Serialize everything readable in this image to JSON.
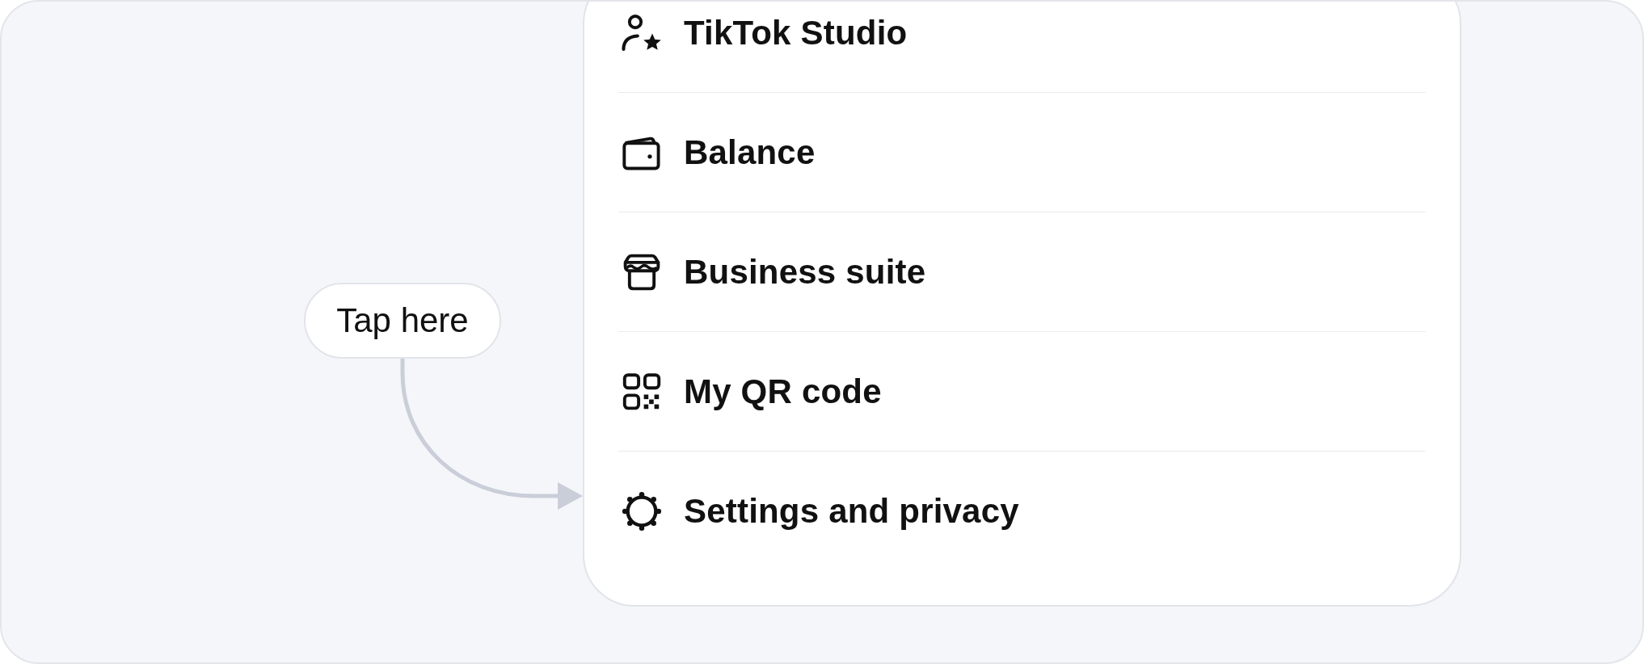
{
  "callout": {
    "text": "Tap here"
  },
  "menu": {
    "items": [
      {
        "kind": "studio",
        "label": "TikTok Studio"
      },
      {
        "kind": "wallet",
        "label": "Balance"
      },
      {
        "kind": "store",
        "label": "Business suite"
      },
      {
        "kind": "qr",
        "label": "My QR code"
      },
      {
        "kind": "settings",
        "label": "Settings and privacy"
      }
    ]
  }
}
